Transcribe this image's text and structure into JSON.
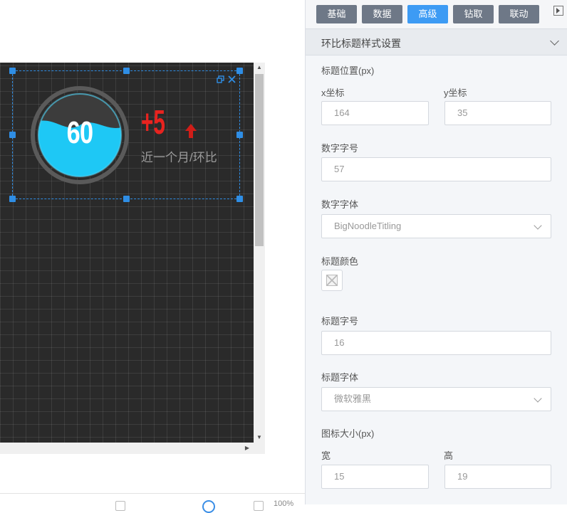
{
  "widget": {
    "gauge_value": "60",
    "delta_value": "+5",
    "period_label": "近一个月/环比"
  },
  "canvas": {
    "zoom_label": "100%"
  },
  "tabs": [
    {
      "label": "基础",
      "active": false
    },
    {
      "label": "数据",
      "active": false
    },
    {
      "label": "高级",
      "active": true
    },
    {
      "label": "钻取",
      "active": false
    },
    {
      "label": "联动",
      "active": false
    }
  ],
  "section": {
    "title": "环比标题样式设置"
  },
  "form": {
    "title_position_label": "标题位置(px)",
    "x_label": "x坐标",
    "x_value": "164",
    "y_label": "y坐标",
    "y_value": "35",
    "number_size_label": "数字字号",
    "number_size_value": "57",
    "number_font_label": "数字字体",
    "number_font_value": "BigNoodleTitling",
    "title_color_label": "标题颜色",
    "title_size_label": "标题字号",
    "title_size_value": "16",
    "title_font_label": "标题字体",
    "title_font_value": "微软雅黑",
    "icon_size_label": "图标大小(px)",
    "width_label": "宽",
    "width_value": "15",
    "height_label": "高",
    "height_value": "19"
  },
  "colors": {
    "accent": "#3d9bf4",
    "tab_bg": "#6e7887",
    "gauge_fill": "#1ec8f5",
    "delta_red": "#e8231f",
    "canvas_bg": "#2a2a2a"
  },
  "icons": {
    "restore": "restore-icon",
    "close": "close-icon",
    "up_arrow": "up-arrow-icon",
    "chevron": "chevron-down-icon",
    "panel_toggle": "panel-collapse-icon"
  }
}
